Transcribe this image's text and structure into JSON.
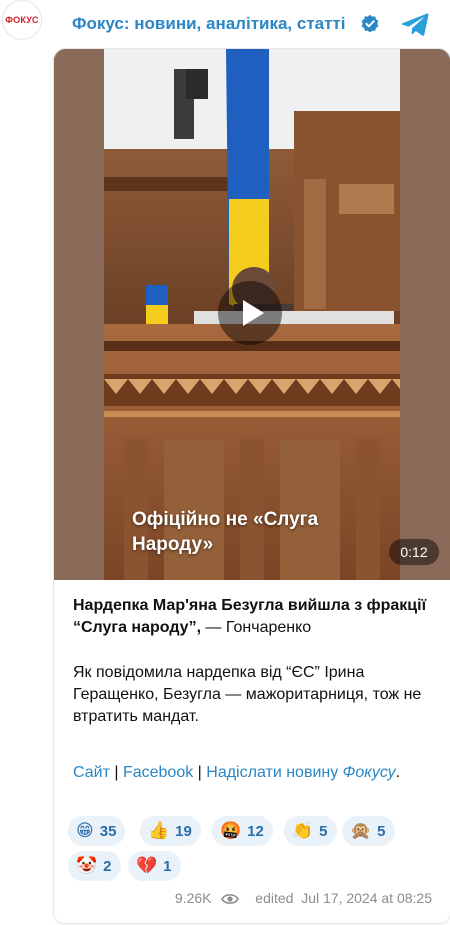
{
  "header": {
    "avatar_text": "ФОКУС",
    "channel_title": "Фокус: новини, аналітика, статті",
    "verified_icon": "verified-badge-icon",
    "telegram_icon": "telegram-logo-icon"
  },
  "video": {
    "caption": "Офіційно не «Слуга Народу»",
    "duration": "0:12",
    "play_icon": "play-icon"
  },
  "post": {
    "headline_bold": "Нардепка Мар'яна Безугла вийшла з фракції “Слуга народу”,",
    "headline_rest": " — Гончаренко",
    "body": "Як повідомила нардепка від “ЄС” Ірина Геращенко, Безугла — мажоритарниця, тож не втратить мандат.",
    "link_site": "Сайт",
    "link_facebook": "Facebook",
    "link_send": "Надіслати новину",
    "link_focus": "Фокусу",
    "sep": " | ",
    "end": "."
  },
  "reactions": [
    {
      "emoji": "😁",
      "count": "35"
    },
    {
      "emoji": "👍",
      "count": "19"
    },
    {
      "emoji": "🤬",
      "count": "12"
    },
    {
      "emoji": "👏",
      "count": "5"
    },
    {
      "emoji": "🙊",
      "count": "5"
    },
    {
      "emoji": "🤡",
      "count": "2"
    },
    {
      "emoji": "💔",
      "count": "1"
    }
  ],
  "meta": {
    "views": "9.26K",
    "views_icon": "eye-icon",
    "edited": "edited",
    "date": "Jul 17, 2024 at 08:25"
  },
  "colors": {
    "accent": "#2a86c5",
    "reaction_bg": "#e9f1f9",
    "flag_blue": "#1f5fbf",
    "flag_yellow": "#f5cd1c"
  }
}
